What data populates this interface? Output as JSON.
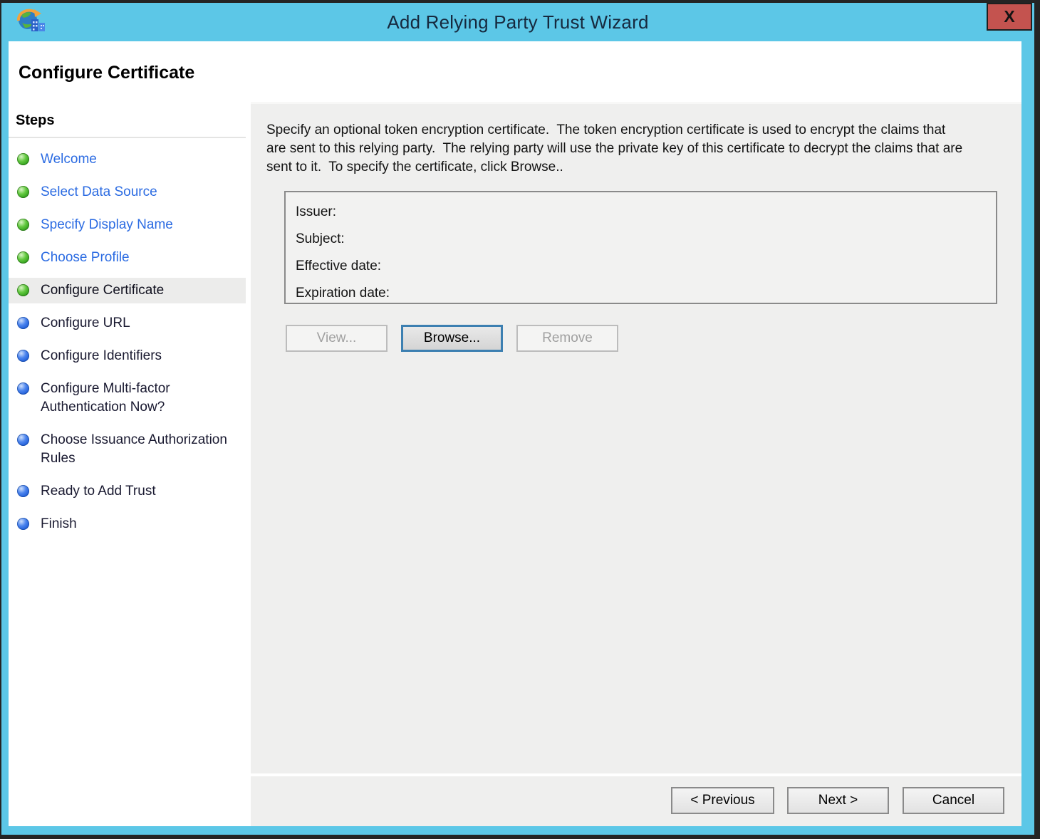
{
  "window": {
    "title": "Add Relying Party Trust Wizard",
    "close_label": "X",
    "page_title": "Configure Certificate"
  },
  "colors": {
    "titlebar": "#5CC7E7",
    "close_button": "#C4534F",
    "link": "#2B6BE2",
    "green_bullet": "#3DB42C",
    "blue_bullet": "#2268E0",
    "content_bg": "#EFEFEE",
    "focus_border": "#3C7FB1"
  },
  "steps": {
    "header": "Steps",
    "items": [
      {
        "label": "Welcome",
        "state": "completed",
        "bullet": "green"
      },
      {
        "label": "Select Data Source",
        "state": "completed",
        "bullet": "green"
      },
      {
        "label": "Specify Display Name",
        "state": "completed",
        "bullet": "green"
      },
      {
        "label": "Choose Profile",
        "state": "completed",
        "bullet": "green"
      },
      {
        "label": "Configure Certificate",
        "state": "current",
        "bullet": "green"
      },
      {
        "label": "Configure URL",
        "state": "upcoming",
        "bullet": "blue"
      },
      {
        "label": "Configure Identifiers",
        "state": "upcoming",
        "bullet": "blue"
      },
      {
        "label": "Configure Multi-factor Authentication Now?",
        "state": "upcoming",
        "bullet": "blue"
      },
      {
        "label": "Choose Issuance Authorization Rules",
        "state": "upcoming",
        "bullet": "blue"
      },
      {
        "label": "Ready to Add Trust",
        "state": "upcoming",
        "bullet": "blue"
      },
      {
        "label": "Finish",
        "state": "upcoming",
        "bullet": "blue"
      }
    ]
  },
  "content": {
    "description": "Specify an optional token encryption certificate.  The token encryption certificate is used to encrypt the claims that are sent to this relying party.  The relying party will use the private key of this certificate to decrypt the claims that are sent to it.  To specify the certificate, click Browse..",
    "certificate_fields": [
      "Issuer:",
      "Subject:",
      "Effective date:",
      "Expiration date:"
    ],
    "buttons": {
      "view": "View...",
      "browse": "Browse...",
      "remove": "Remove"
    }
  },
  "footer": {
    "previous": "< Previous",
    "next": "Next >",
    "cancel": "Cancel"
  }
}
